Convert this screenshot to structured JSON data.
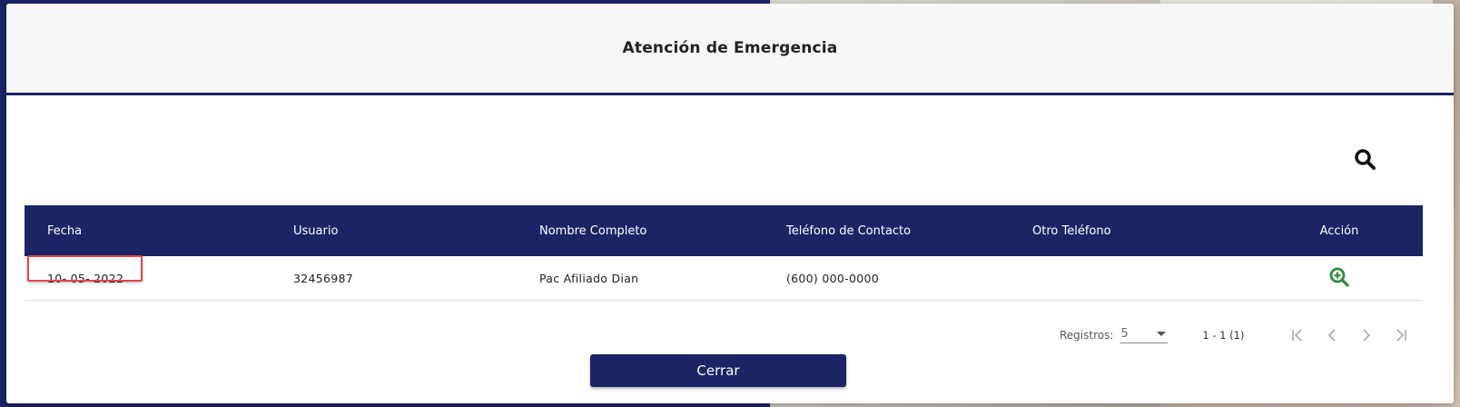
{
  "dialog": {
    "title": "Atención de Emergencia",
    "close_label": "Cerrar"
  },
  "table": {
    "columns": [
      "Fecha",
      "Usuario",
      "Nombre Completo",
      "Teléfono de Contacto",
      "Otro Teléfono",
      "Acción"
    ],
    "rows": [
      {
        "fecha": "10- 05- 2022",
        "usuario": "32456987",
        "nombre": "Pac Afiliado Dian",
        "telefono": "(600) 000-0000",
        "otro_telefono": "",
        "action_icon": "zoom-in-icon"
      }
    ]
  },
  "pager": {
    "label": "Registros:",
    "page_size": "5",
    "range": "1 - 1 (1)"
  },
  "colors": {
    "primary": "#1c2466",
    "action_green": "#2e8b3e",
    "highlight_red": "#e04848"
  }
}
